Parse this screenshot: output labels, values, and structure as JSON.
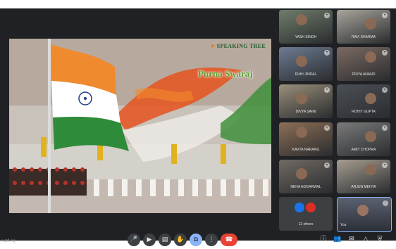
{
  "meeting": {
    "code": "r-qrf-roj"
  },
  "presentation": {
    "logo": "SPEAKING TREE",
    "caption": "Purna Swaraj"
  },
  "participants": [
    {
      "name": "YASH SINGH",
      "tone": "#6f7d6a"
    },
    {
      "name": "RAVI SHARMA",
      "tone": "#a8a49b"
    },
    {
      "name": "RUHI JINDAL",
      "tone": "#6d7b92"
    },
    {
      "name": "PRIYA ANAND",
      "tone": "#7b6a62"
    },
    {
      "name": "DIVYA SAINI",
      "tone": "#9a8f7a"
    },
    {
      "name": "ROHIT GUPTA",
      "tone": "#4b5056"
    },
    {
      "name": "KAVYA NARANG",
      "tone": "#8d6f55"
    },
    {
      "name": "AMIT CHOPRA",
      "tone": "#7a7a7a"
    },
    {
      "name": "NEHA AGGARWAL",
      "tone": "#716a63"
    },
    {
      "name": "ARJUN MEHTA",
      "tone": "#a69d90"
    }
  ],
  "others": {
    "label": "12 others"
  },
  "self": {
    "label": "You"
  },
  "controls": {
    "mic": "🎤",
    "camera": "▶",
    "captions": "▤",
    "hand": "✋",
    "present": "⧉",
    "more": "⋮",
    "end": "☎"
  },
  "right_controls": {
    "info": "ⓘ",
    "people": "👥",
    "chat": "✉",
    "activities": "△",
    "host": "⛨"
  },
  "colors": {
    "accent": "#8ab4f8",
    "end_call": "#ea4335"
  }
}
